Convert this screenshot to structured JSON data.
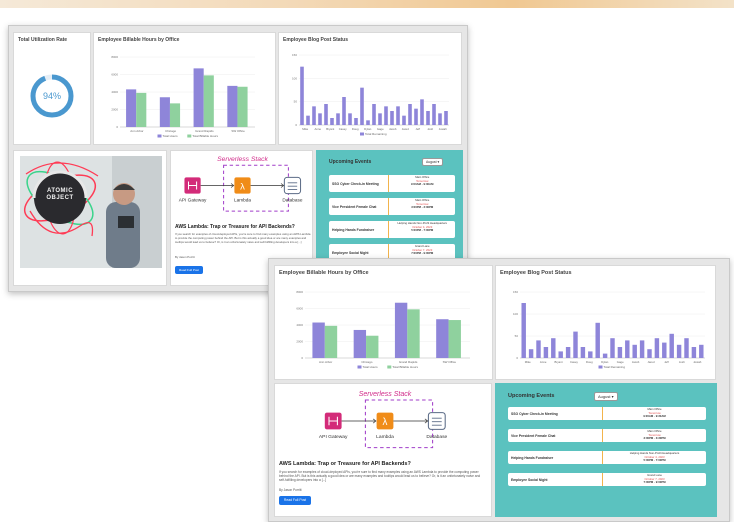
{
  "back": {
    "utilization": {
      "title": "Total Utilization Rate",
      "value": "94%",
      "fraction": 0.94
    },
    "billable_title": "Employee Billable Hours by Office",
    "blog_title": "Employee Blog Post Status",
    "blog_post": {
      "title": "AWS Lambda: Trap or Treasure for API Backends?",
      "text": "If you search for examples of cloud-deployed APIs, you're sure to find many examples using an AWS Lambda to provide the computing power behind the API. But is this actually a good idea or are many examples and tooltips would lead us to believe? Or, is it an unfortunately naive and self-fulfilling developers into a [...]",
      "author": "By Jason Porritt",
      "button": "Read Full Post"
    },
    "events": {
      "heading": "Upcoming Events",
      "dropdown": "August ▾",
      "items": [
        {
          "name": "SSO Cyber Check-in Meeting",
          "location": "Main Office",
          "date": "Tomorrow",
          "time": "9:00AM - 9:30AM"
        },
        {
          "name": "Vice President Female Chat",
          "location": "Main Office",
          "date": "Tomorrow",
          "time": "3:00PM - 3:30PM"
        },
        {
          "name": "Helping Hands Fundraiser",
          "location": "Helping Hands Non-Profit Headquarters",
          "date": "October 4, 2023",
          "time": "5:00PM - 7:00PM"
        },
        {
          "name": "Employee Social Night",
          "location": "Grand Lane",
          "date": "October 7, 2023",
          "time": "7:00PM - 9:00PM"
        }
      ]
    }
  },
  "front": {
    "billable_title": "Employee Billable Hours by Office",
    "blog_title": "Employee Blog Post Status",
    "blog_post": {
      "title": "AWS Lambda: Trap or Treasure for API Backends?",
      "text": "If you search for examples of cloud-deployed APIs, you're sure to find many examples using an AWS Lambda to provide the computing power behind the API. But is this actually a good idea or are many examples and tooltips would lead us to believe? Or, is it an unfortunately naive and self-fulfilling developers into a [...]",
      "author": "By Jason Porritt",
      "button": "Read Full Post"
    },
    "events": {
      "heading": "Upcoming Events",
      "dropdown": "August ▾",
      "items": [
        {
          "name": "SSO Cyber Check-in Meeting",
          "location": "Main Office",
          "date": "Tomorrow",
          "time": "9:00AM - 9:30AM"
        },
        {
          "name": "Vice President Female Chat",
          "location": "Main Office",
          "date": "Tomorrow",
          "time": "3:00PM - 3:30PM"
        },
        {
          "name": "Helping Hands Fundraiser",
          "location": "Helping Hands Non-Profit Headquarters",
          "date": "October 4, 2023",
          "time": "5:00PM - 7:00PM"
        },
        {
          "name": "Employee Social Night",
          "location": "Grand Lane",
          "date": "October 7, 2023",
          "time": "7:00PM - 9:00PM"
        }
      ]
    }
  },
  "diagram": {
    "handwritten_title": "Serverless Stack",
    "gateway_label": "API Gateway",
    "lambda_label": "Lambda",
    "database_label": "Database"
  },
  "photo": {
    "sign_text": "ATOMIC OBJECT"
  },
  "chart_data": [
    {
      "type": "bar",
      "title": "Employee Billable Hours by Office",
      "categories": [
        "Ann Arbor",
        "Chicago",
        "Grand Rapids",
        "SW Office"
      ],
      "ylim": [
        0,
        8000
      ],
      "yticks": [
        "0",
        "2000",
        "4000",
        "6000",
        "8000"
      ],
      "series": [
        {
          "name": "Total Hours",
          "values": [
            4300,
            3400,
            6700,
            4700
          ]
        },
        {
          "name": "Total Billable Hours",
          "values": [
            3900,
            2700,
            5900,
            4600
          ]
        }
      ],
      "colors": [
        "#8e85d9",
        "#8fd19e"
      ],
      "legend": "bottom"
    },
    {
      "type": "bar",
      "title": "Employee Blog Post Status",
      "categories": [
        "Mike",
        "Anne",
        "Bryant",
        "Casey",
        "Doug",
        "Dylan",
        "Gage",
        "Jacob",
        "Jared",
        "Jeff",
        "Josh",
        "Josiah"
      ],
      "ylim": [
        0,
        150
      ],
      "yticks": [
        "0",
        "50",
        "100",
        "150"
      ],
      "series": [
        {
          "name": "Total Remaining",
          "values": [
            125,
            20,
            40,
            25,
            45,
            15,
            25,
            60,
            25,
            15,
            80,
            10,
            45,
            25,
            40,
            30,
            40,
            20,
            45,
            35,
            55,
            30,
            45,
            25,
            30
          ]
        }
      ],
      "colors": [
        "#8e85d9"
      ],
      "legend": "bottom"
    }
  ]
}
